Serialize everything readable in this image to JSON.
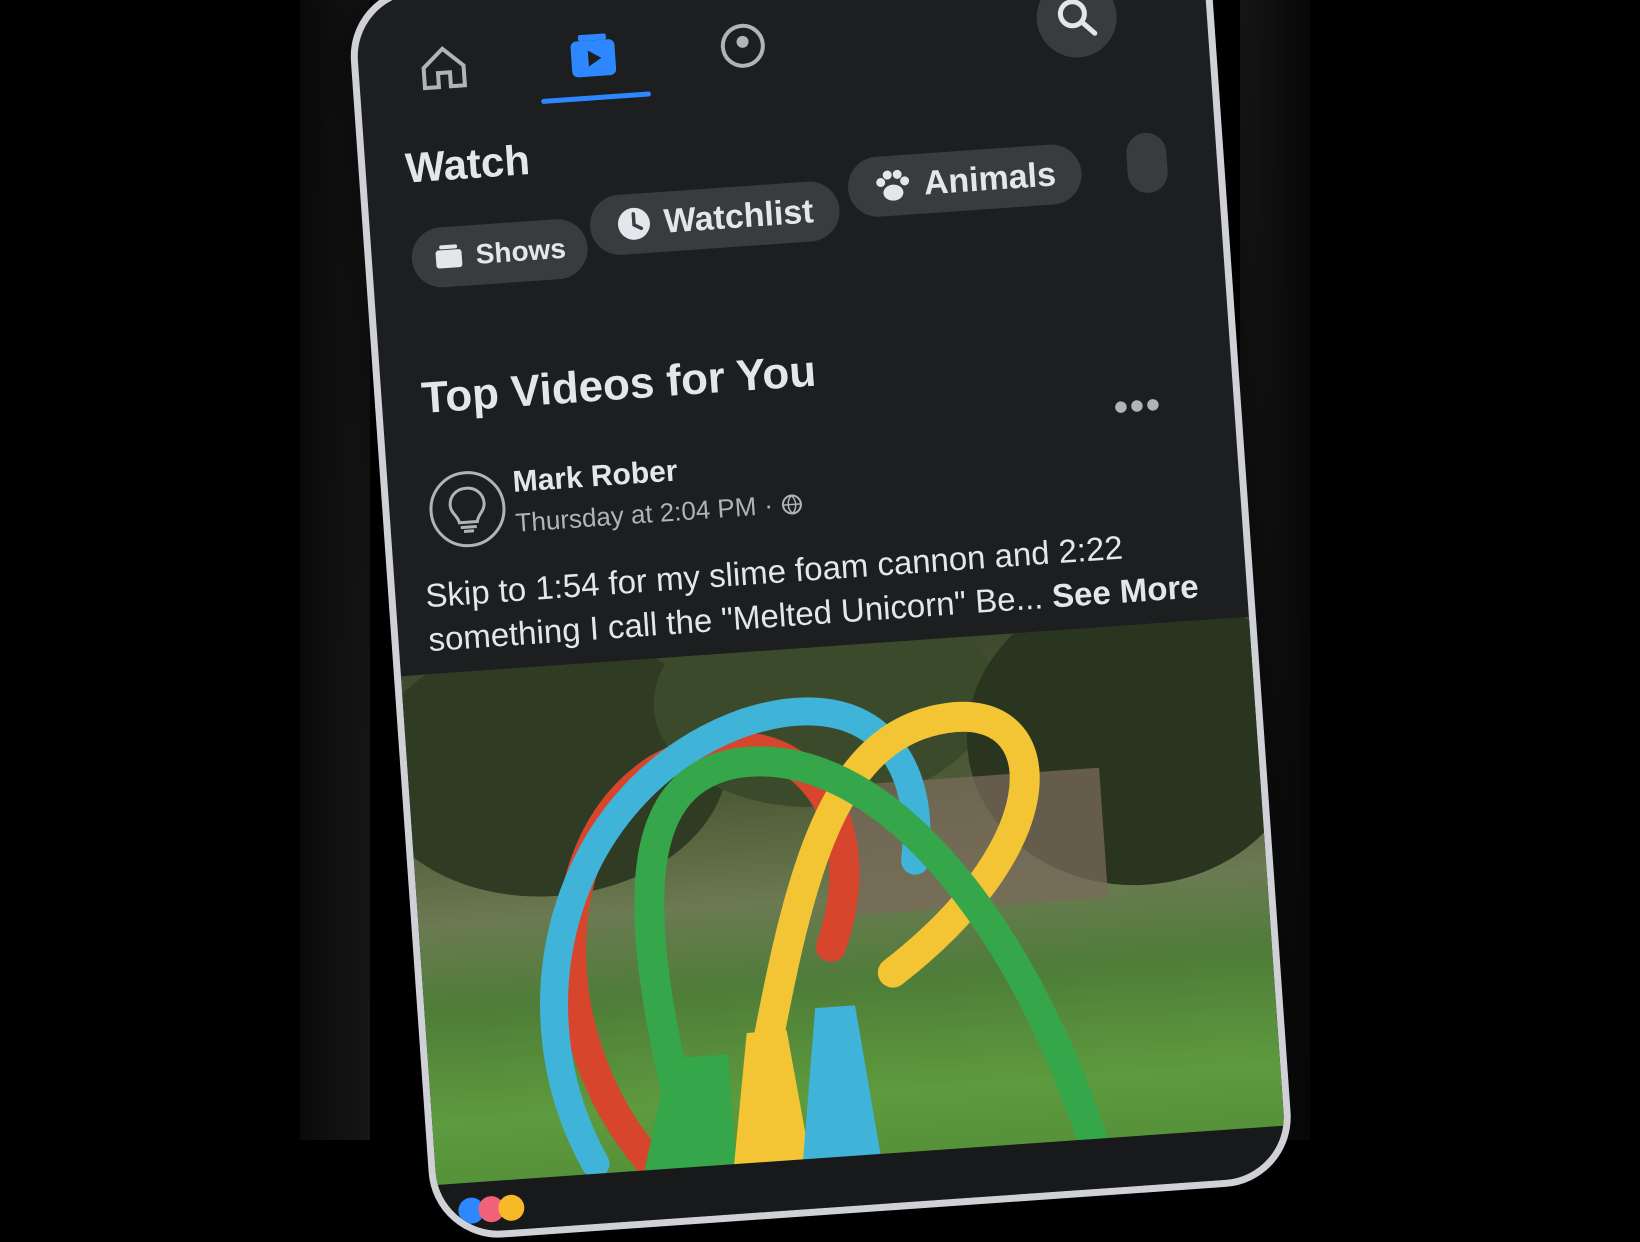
{
  "nav": {
    "tabs": [
      {
        "name": "home",
        "icon": "home-icon"
      },
      {
        "name": "watch",
        "icon": "watch-icon",
        "active": true
      },
      {
        "name": "groups",
        "icon": "groups-icon"
      }
    ],
    "search_icon": "search-icon"
  },
  "page_title": "Watch",
  "filters": [
    {
      "label": "Shows",
      "icon": "shows-icon"
    },
    {
      "label": "Watchlist",
      "icon": "clock-icon"
    },
    {
      "label": "Animals",
      "icon": "paw-icon"
    }
  ],
  "section_title": "Top Videos for You",
  "post": {
    "author": "Mark Rober",
    "timestamp": "Thursday at 2:04 PM",
    "separator": "·",
    "privacy_icon": "globe-icon",
    "caption_text": "Skip to 1:54 for my slime foam cannon and 2:22 something I call the \"Melted Unicorn\"  Be...",
    "see_more": "See More",
    "more_icon": "•••"
  },
  "colors": {
    "accent": "#2d88ff",
    "background": "#1d1e20",
    "pill": "#3a3b3c",
    "text_primary": "#e4e6eb",
    "text_secondary": "#b0b3b8"
  }
}
